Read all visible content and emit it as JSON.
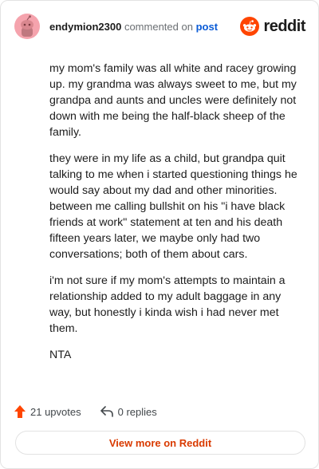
{
  "header": {
    "username": "endymion2300",
    "commented_on": "commented on",
    "post_link": "post",
    "brand": "reddit"
  },
  "comment": {
    "paragraphs": [
      "my mom's family was all white and racey growing up. my grandma was always sweet to me, but my grandpa and aunts and uncles were definitely not down with me being the half-black sheep of the family.",
      "they were in my life as a child, but grandpa quit talking to me when i started questioning things he would say about my dad and other minorities. between me calling bullshit on his \"i have black friends at work\" statement at ten and his death fifteen years later, we maybe only had two conversations; both of them about cars.",
      "i'm not sure if my mom's attempts to maintain a relationship added to my adult baggage in any way, but honestly i kinda wish i had never met them.",
      "NTA"
    ]
  },
  "footer": {
    "upvotes": "21 upvotes",
    "replies": "0 replies"
  },
  "view_more": "View more on Reddit",
  "colors": {
    "brand_orange": "#ff4500",
    "link_blue": "#0a5bd6",
    "view_more_text": "#d93a00"
  }
}
